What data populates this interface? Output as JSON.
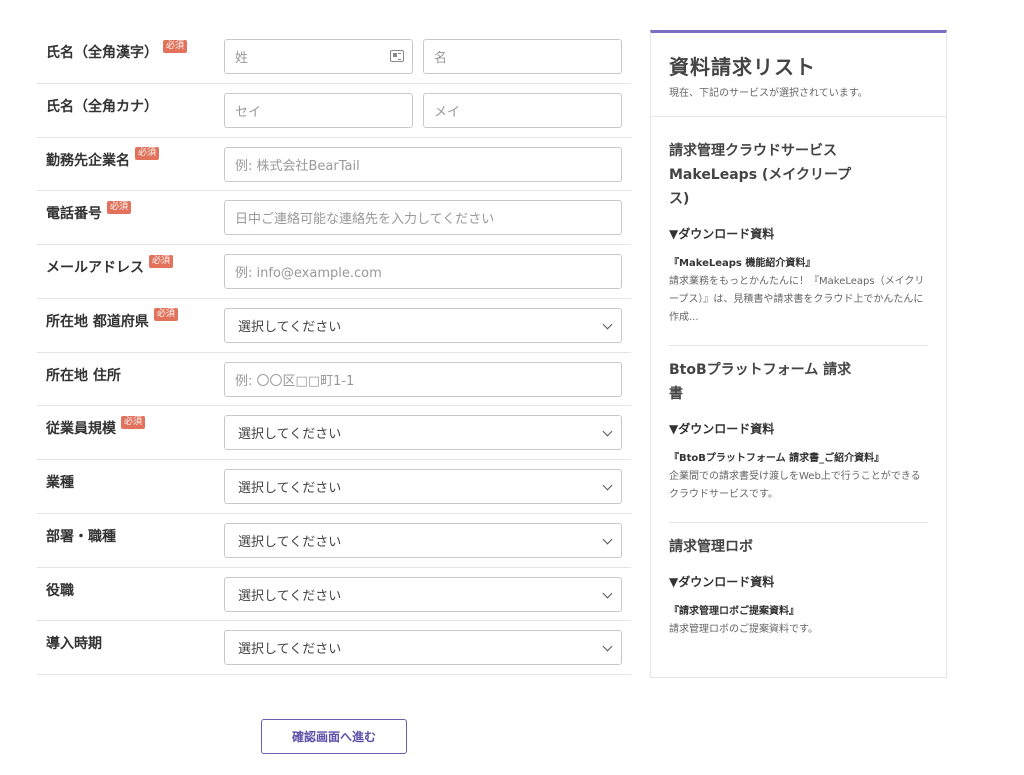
{
  "required_label": "必須",
  "fields": [
    {
      "label": "氏名（全角漢字）",
      "required": true,
      "placeholders": [
        "姓",
        "名"
      ]
    },
    {
      "label": "氏名（全角カナ）",
      "required": false,
      "placeholders": [
        "セイ",
        "メイ"
      ]
    },
    {
      "label": "勤務先企業名",
      "required": true,
      "placeholder": "例: 株式会社BearTail"
    },
    {
      "label": "電話番号",
      "required": true,
      "placeholder": "日中ご連絡可能な連絡先を入力してください"
    },
    {
      "label": "メールアドレス",
      "required": true,
      "placeholder": "例: info@example.com"
    },
    {
      "label": "所在地 都道府県",
      "required": true,
      "select": "選択してください"
    },
    {
      "label": "所在地 住所",
      "required": false,
      "placeholder": "例: 〇〇区□□町1-1"
    },
    {
      "label": "従業員規模",
      "required": true,
      "select": "選択してください"
    },
    {
      "label": "業種",
      "required": false,
      "select": "選択してください"
    },
    {
      "label": "部署・職種",
      "required": false,
      "select": "選択してください"
    },
    {
      "label": "役職",
      "required": false,
      "select": "選択してください"
    },
    {
      "label": "導入時期",
      "required": false,
      "select": "選択してください"
    }
  ],
  "submit_label": "確認画面へ進む",
  "panel": {
    "title": "資料請求リスト",
    "subtitle": "現在、下記のサービスが選択されています。",
    "services": [
      {
        "name": "請求管理クラウドサービス MakeLeaps (メイクリープス)",
        "download_heading": "▼ダウンロード資料",
        "doc_title": "『MakeLeaps 機能紹介資料』",
        "description": "請求業務をもっとかんたんに！『MakeLeaps（メイクリープス）』は、見積書や請求書をクラウド上でかんたんに作成..."
      },
      {
        "name": "BtoBプラットフォーム 請求書",
        "download_heading": "▼ダウンロード資料",
        "doc_title": "『BtoBプラットフォーム 請求書_ご紹介資料』",
        "description": "企業間での請求書受け渡しをWeb上で行うことができるクラウドサービスです。"
      },
      {
        "name": "請求管理ロボ",
        "download_heading": "▼ダウンロード資料",
        "doc_title": "『請求管理ロボご提案資料』",
        "description": "請求管理ロボのご提案資料です。"
      }
    ]
  }
}
